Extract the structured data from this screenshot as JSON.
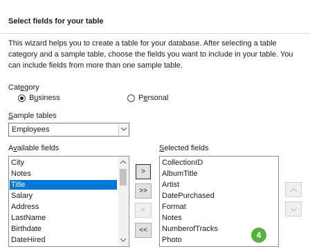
{
  "wizard": {
    "title": "Select fields for your table",
    "description": "This wizard helps you to create a table for your database. After selecting a table category and a sample table, choose the fields you want to include in your table. You can include fields from more than one sample table."
  },
  "category": {
    "label_pre": "Cat",
    "label_ul": "e",
    "label_post": "gory",
    "options": [
      {
        "pre": "B",
        "ul": "u",
        "post": "siness",
        "checked": true
      },
      {
        "pre": "P",
        "ul": "e",
        "post": "rsonal",
        "checked": false
      }
    ]
  },
  "sample_tables": {
    "label_ul": "S",
    "label_post": "ample tables",
    "selected": "Employees"
  },
  "available_fields": {
    "label_pre": "A",
    "label_ul": "v",
    "label_post": "ailable fields",
    "items": [
      "City",
      "Notes",
      "Title",
      "Salary",
      "Address",
      "LastName",
      "Birthdate",
      "DateHired"
    ],
    "selected_index": 2
  },
  "selected_fields": {
    "label_ul": "S",
    "label_post": "elected fields",
    "items": [
      "CollectionID",
      "AlbumTitle",
      "Artist",
      "DatePurchased",
      "Format",
      "Notes",
      "NumberofTracks",
      "Photo"
    ]
  },
  "buttons": {
    "add_one": ">",
    "add_all": ">>",
    "remove_one": "<",
    "remove_all": "<<"
  },
  "step_badge": "4"
}
